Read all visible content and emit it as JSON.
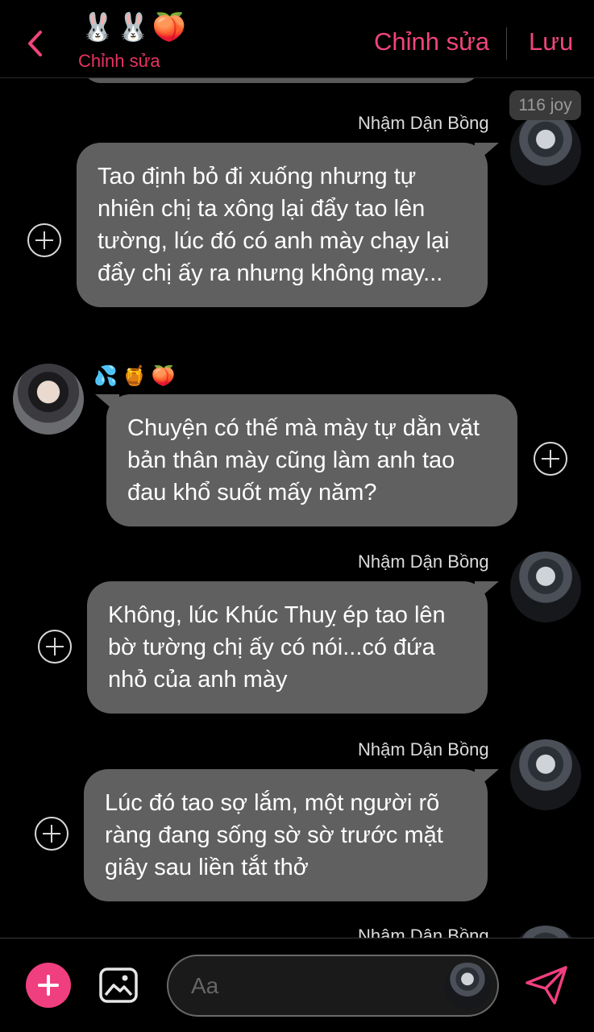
{
  "header": {
    "chat_emoji": "🐰🐰🍑",
    "chat_name": "Chỉnh sửa",
    "edit_label": "Chỉnh sửa",
    "save_label": "Lưu"
  },
  "messages": [
    {
      "sender": "Nhậm Dận Bồng",
      "badge": "116 joy",
      "text": "Tao định bỏ đi xuống nhưng tự nhiên chị ta xông lại đẩy tao lên tường, lúc đó có anh mày chạy lại đẩy chị ấy ra nhưng không may..."
    },
    {
      "reactions": "💦🍯🍑",
      "text": "Chuyện có thế mà mày tự dằn vặt bản thân mày cũng làm anh tao đau khổ suốt mấy năm?"
    },
    {
      "sender": "Nhậm Dận Bồng",
      "text": "Không, lúc Khúc Thuỵ ép tao lên bờ tường chị ấy có nói...có đứa nhỏ của anh mày"
    },
    {
      "sender": "Nhậm Dận Bồng",
      "text": "Lúc đó tao sợ lắm, một người rõ ràng đang sống sờ sờ trước mặt giây sau liền tắt thở"
    },
    {
      "sender": "Nhậm Dận Bồng"
    }
  ],
  "composer": {
    "placeholder": "Aa"
  },
  "colors": {
    "accent": "#f03f7e",
    "header_text": "#f0457a",
    "bubble": "#606060",
    "background": "#000000"
  },
  "icons": {
    "back": "chevron-left-icon",
    "add": "plus-icon",
    "attach": "image-icon",
    "send": "send-icon",
    "message_action": "plus-circle-icon"
  }
}
